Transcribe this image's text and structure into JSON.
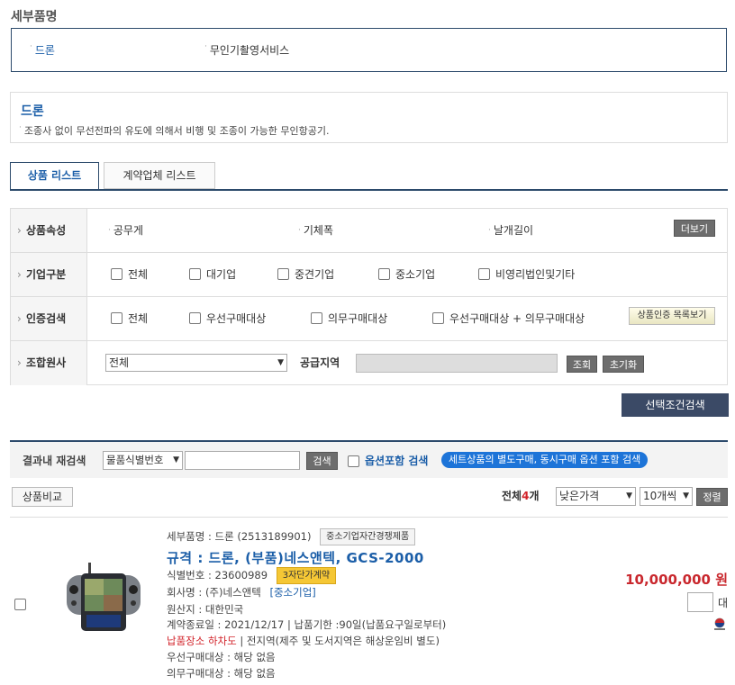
{
  "page_title": "세부품명",
  "category": {
    "item1": "드론",
    "item2": "무인기촬영서비스"
  },
  "description": {
    "title": "드론",
    "text": "조종사 없이 무선전파의 유도에 의해서 비행 및 조종이 가능한 무인항공기."
  },
  "tabs": {
    "product_list": "상품 리스트",
    "vendor_list": "계약업체 리스트"
  },
  "filters": {
    "attr": {
      "label": "상품속성",
      "items": [
        "공무게",
        "기체폭",
        "날개길이"
      ],
      "more": "더보기"
    },
    "company": {
      "label": "기업구분",
      "options": [
        "전체",
        "대기업",
        "중견기업",
        "중소기업",
        "비영리법인및기타"
      ]
    },
    "cert": {
      "label": "인증검색",
      "options": [
        "전체",
        "우선구매대상",
        "의무구매대상",
        "우선구매대상 + 의무구매대상"
      ],
      "list_button": "상품인증 목록보기"
    },
    "union": {
      "label": "조합원사",
      "select_value": "전체",
      "region_label": "공급지역",
      "search": "조회",
      "reset": "초기화"
    }
  },
  "search_button": "선택조건검색",
  "result_search": {
    "label": "결과내 재검색",
    "select_value": "물품식별번호",
    "search": "검색",
    "option_label": "옵션포함 검색",
    "option_info": "세트상품의 별도구매, 동시구매 옵션 포함 검색"
  },
  "compare_button": "상품비교",
  "total": {
    "prefix": "전체",
    "count": "4",
    "suffix": "개"
  },
  "sort": {
    "value": "낮은가격",
    "per_page": "10개씩",
    "button": "정렬"
  },
  "product": {
    "subname_label": "세부품명 :",
    "subname_value": "드론 (2513189901)",
    "badge1": "중소기업자간경쟁제품",
    "spec": "규격 : 드론, (부품)네스앤텍, GCS-2000",
    "id_label": "식별번호 :",
    "id_value": "23600989",
    "badge2": "3자단가계약",
    "company_label": "회사명 :",
    "company_value": "(주)네스앤텍",
    "company_type": "[중소기업]",
    "origin": "원산지 : 대한민국",
    "contract": "계약종료일 : 2021/12/17 | 납품기한 :90일(납품요구일로부터)",
    "delivery_label": "납품장소 하차도",
    "delivery_value": "| 전지역(제주 및 도서지역은 해상운임비 별도)",
    "priority": "우선구매대상 : 해당 없음",
    "mandatory": "의무구매대상 : 해당 없음",
    "price": "10,000,000 원",
    "qty_unit": "대"
  }
}
